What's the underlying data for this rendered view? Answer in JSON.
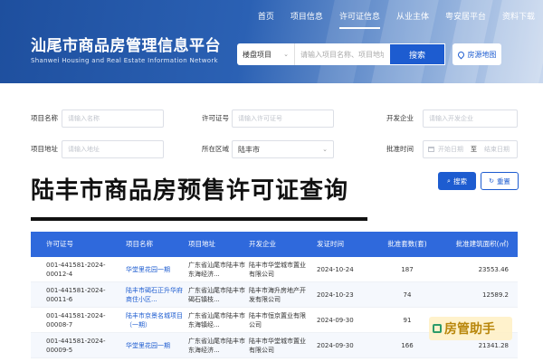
{
  "header": {
    "title": "汕尾市商品房管理信息平台",
    "subtitle": "Shanwei Housing and Real Estate Information Network",
    "nav": [
      {
        "label": "首页"
      },
      {
        "label": "项目信息"
      },
      {
        "label": "许可证信息",
        "active": true
      },
      {
        "label": "从业主体"
      },
      {
        "label": "粤安居平台"
      },
      {
        "label": "资料下载"
      }
    ],
    "search": {
      "select_value": "楼盘项目",
      "placeholder": "请输入项目名称、项目地址、开",
      "button_label": "搜索",
      "map_label": "房源地图"
    }
  },
  "filters": {
    "project_name": {
      "label": "项目名称",
      "placeholder": "请输入名称"
    },
    "license_no": {
      "label": "许可证号",
      "placeholder": "请输入许可证号"
    },
    "developer": {
      "label": "开发企业",
      "placeholder": "请输入开发企业"
    },
    "project_address": {
      "label": "项目地址",
      "placeholder": "请输入地址"
    },
    "region": {
      "label": "所在区域",
      "value": "陆丰市"
    },
    "approval_time": {
      "label": "批准时间",
      "start_placeholder": "开始日期",
      "separator": "至",
      "end_placeholder": "结束日期"
    },
    "search_label": "搜索",
    "reset_label": "重置"
  },
  "overlay_title": "陆丰市商品房预售许可证查询",
  "table": {
    "columns": [
      "许可证号",
      "项目名称",
      "项目地址",
      "开发企业",
      "发证时间",
      "批准套数(套)",
      "批准建筑面积(㎡)"
    ],
    "rows": [
      [
        "001-441581-2024-00012-4",
        "华堂里花园一期",
        "广东省汕尾市陆丰市东海经济...",
        "陆丰市华堂城市置业有限公司",
        "2024-10-24",
        "187",
        "23553.46"
      ],
      [
        "001-441581-2024-00011-6",
        "陆丰市碣石正升华府商住小区...",
        "广东省汕尾市陆丰市碣石镇枝...",
        "陆丰市海升房地产开发有限公司",
        "2024-10-23",
        "74",
        "12589.2"
      ],
      [
        "001-441581-2024-00008-7",
        "陆丰市京景名城项目（一期）",
        "广东省汕尾市陆丰市东海镇经...",
        "陆丰市恒京置业有限公司",
        "2024-09-30",
        "91",
        ""
      ],
      [
        "001-441581-2024-00009-5",
        "华堂里花园一期",
        "广东省汕尾市陆丰市东海经济...",
        "陆丰市华堂城市置业有限公司",
        "2024-09-30",
        "166",
        "21341.28"
      ]
    ]
  },
  "watermark": {
    "text": "房管助手"
  }
}
